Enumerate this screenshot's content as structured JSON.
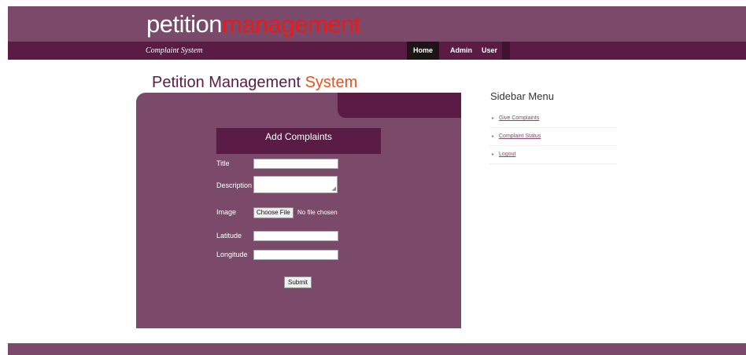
{
  "header": {
    "logo_part1": "petition",
    "logo_part2": "management",
    "tagline": "Complaint System"
  },
  "nav": {
    "home": "Home",
    "admin": "Admin",
    "user": "User"
  },
  "main": {
    "title_part1": "Petition Management",
    "title_part2": "System"
  },
  "form": {
    "header": "Add Complaints",
    "title_label": "Title",
    "description_label": "Description",
    "image_label": "Image",
    "choose_file_label": "Choose File",
    "file_status": "No file chosen",
    "latitude_label": "Latitude",
    "longitude_label": "Longitude",
    "title_value": "",
    "description_value": "",
    "latitude_value": "",
    "longitude_value": "",
    "submit_label": "Submit"
  },
  "sidebar": {
    "title": "Sidebar Menu",
    "items": [
      {
        "label": "Give Complaints"
      },
      {
        "label": "Complaint Status"
      },
      {
        "label": "Logout"
      }
    ]
  },
  "colors": {
    "primary": "#7b4a6b",
    "dark": "#5a1c45",
    "logo_accent": "#e81a1a",
    "title_accent": "#e8541a"
  },
  "icons": {
    "sidebar_bullet": "caret-right-icon",
    "textarea_resize": "resize-grip-icon"
  }
}
